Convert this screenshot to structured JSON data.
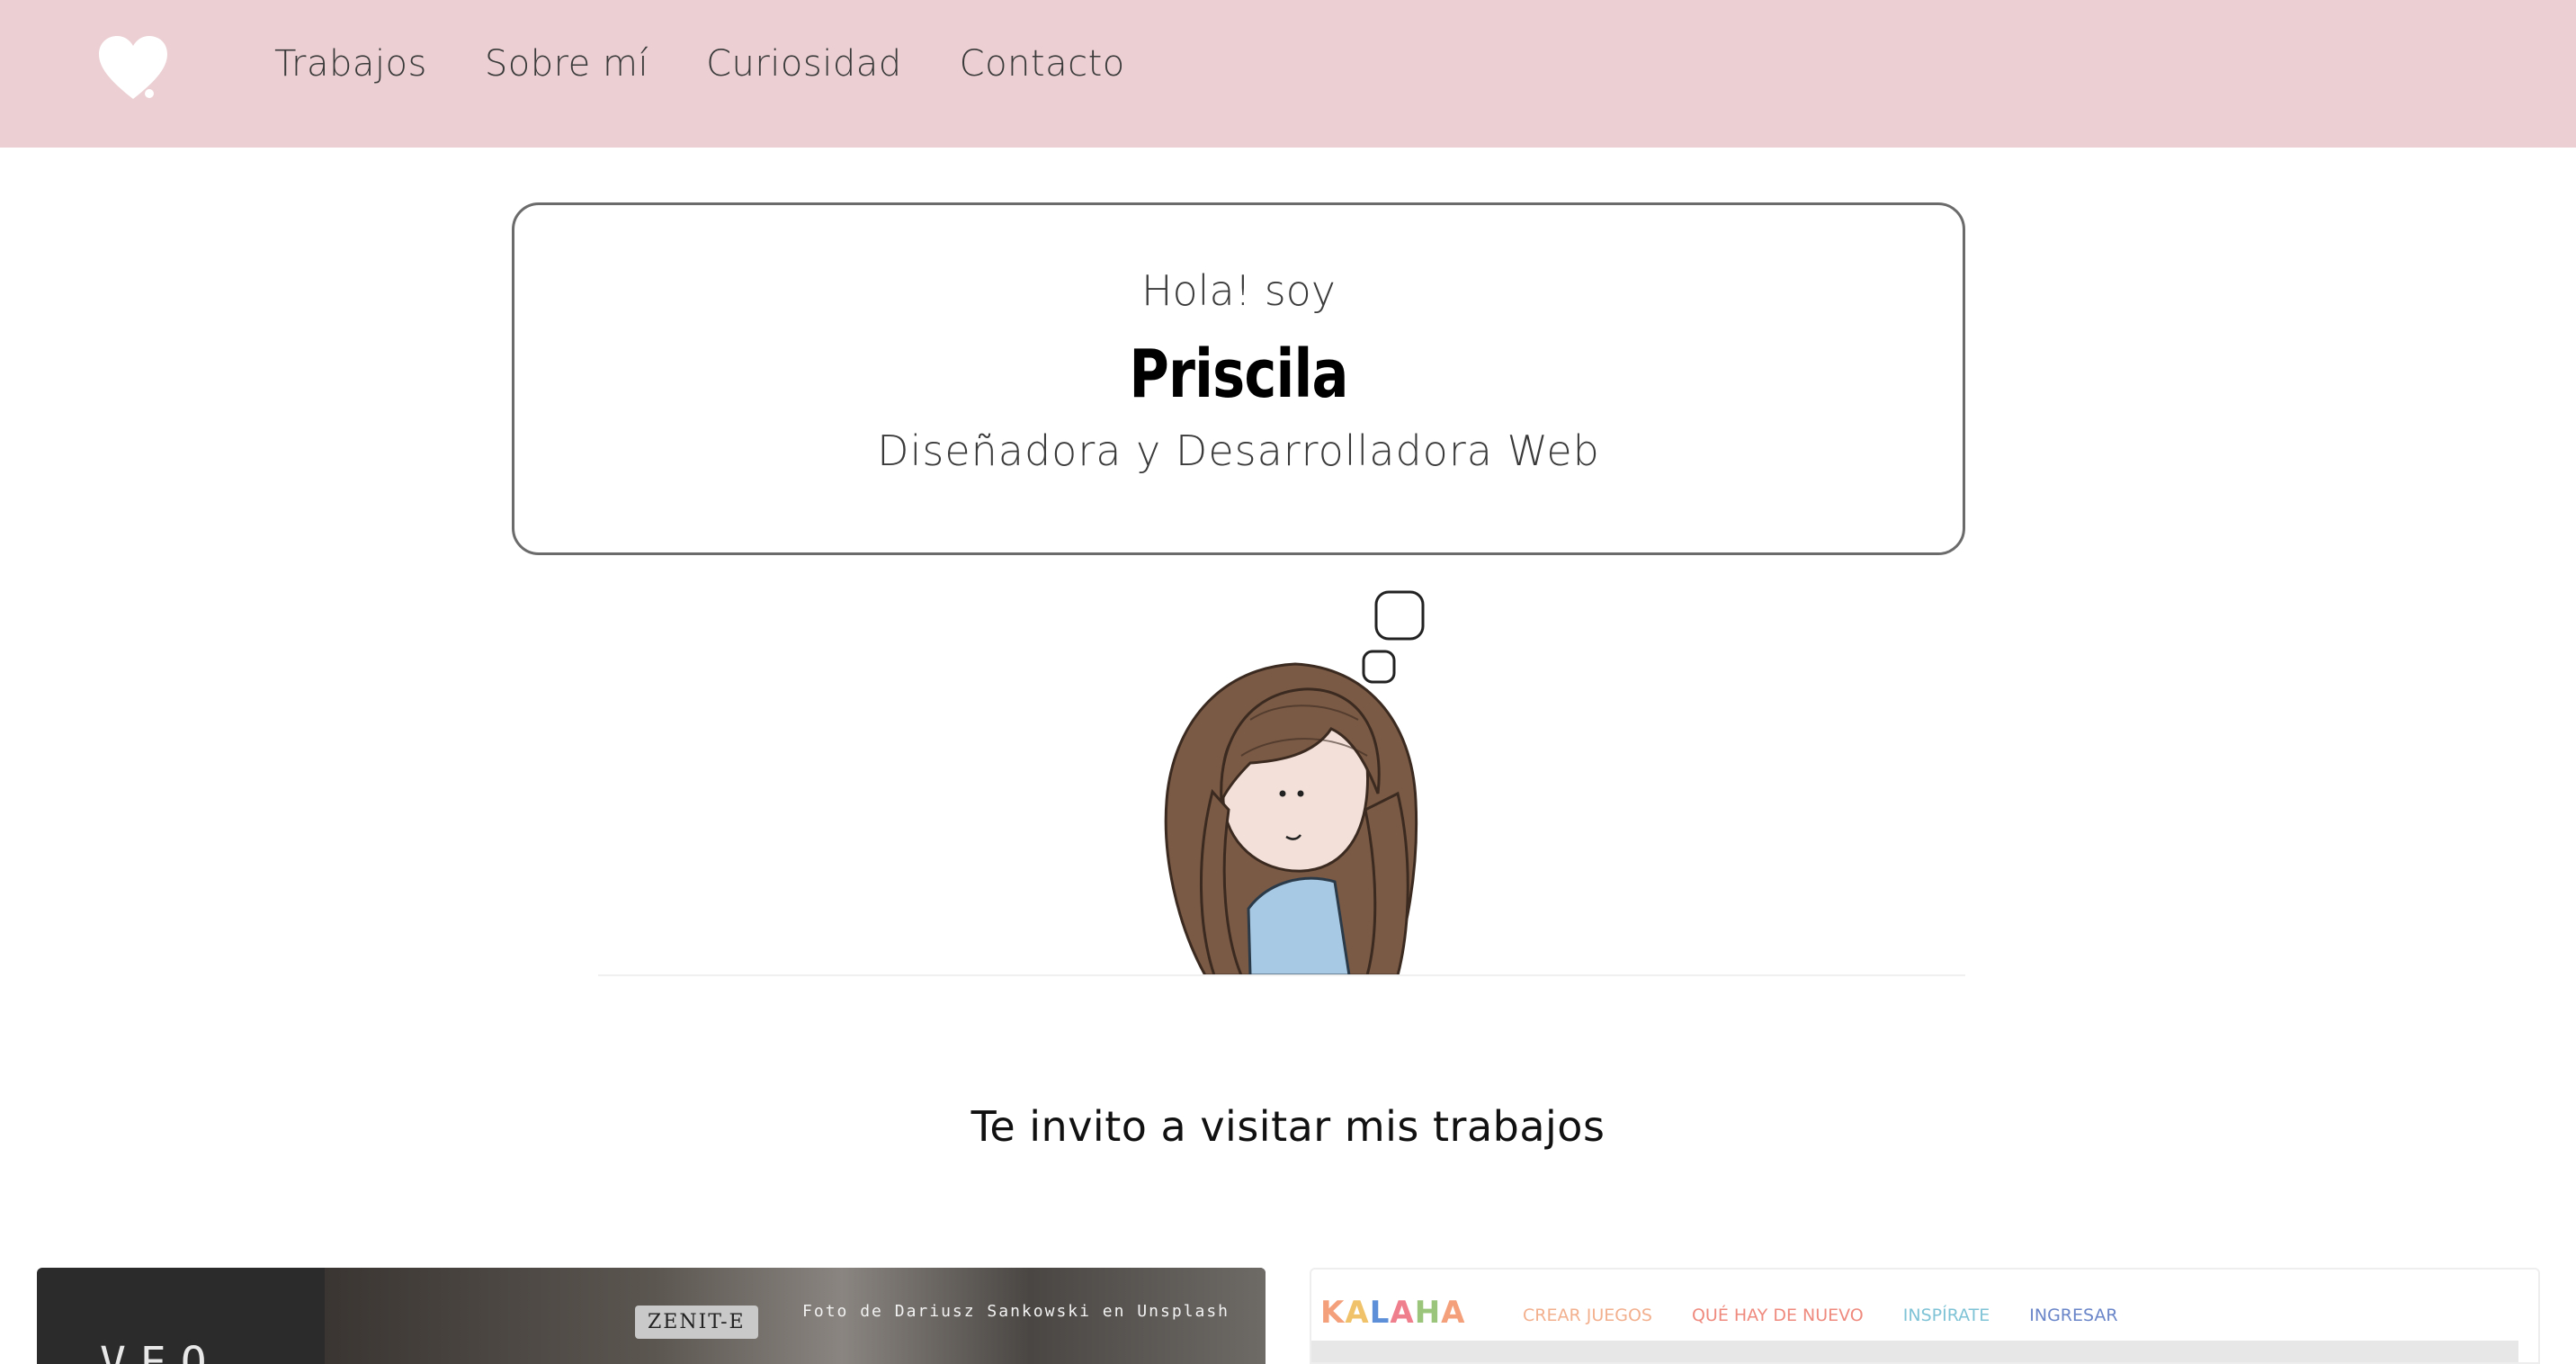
{
  "header": {
    "nav": [
      {
        "label": "Trabajos"
      },
      {
        "label": "Sobre mí"
      },
      {
        "label": "Curiosidad"
      },
      {
        "label": "Contacto"
      }
    ],
    "background_color": "#ebcfd2"
  },
  "intro": {
    "greeting": "Hola! soy",
    "name": "Priscila",
    "role": "Diseñadora y Desarrolladora Web"
  },
  "works": {
    "heading": "Te invito a visitar mis trabajos",
    "projects": [
      {
        "title": "VEO",
        "credit": "Foto de Dariusz Sankowski en Unsplash",
        "camera_label": "ZENIT-E"
      },
      {
        "logo": "KALAHA",
        "nav": [
          {
            "label": "CREAR JUEGOS",
            "color": "#f3b08e"
          },
          {
            "label": "QUÉ HAY DE NUEVO",
            "color": "#ef8a7e"
          },
          {
            "label": "INSPÍRATE",
            "color": "#7fc3d6"
          },
          {
            "label": "INGRESAR",
            "color": "#6a86c9"
          }
        ]
      }
    ]
  },
  "icons": {
    "logo": "heart-icon",
    "avatar": "girl-illustration"
  }
}
